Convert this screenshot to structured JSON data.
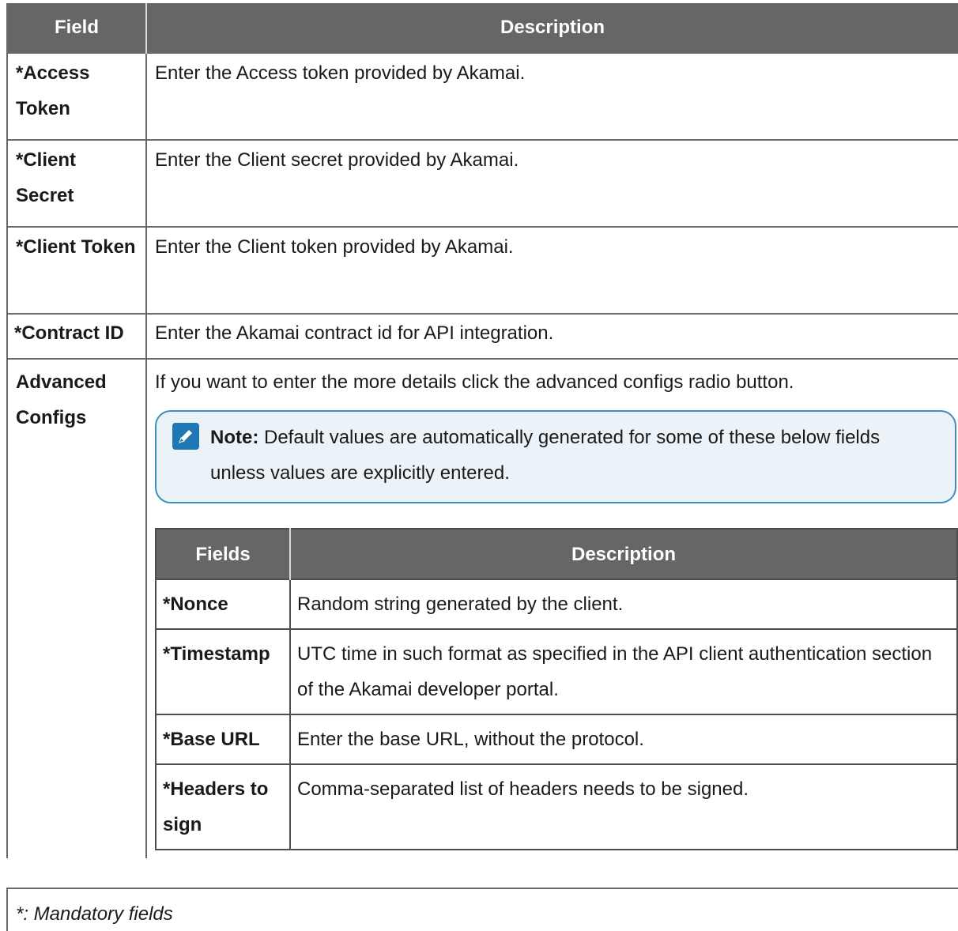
{
  "main_table": {
    "headers": {
      "field": "Field",
      "description": "Description"
    },
    "rows": [
      {
        "field": "*Access Token",
        "description": "Enter the Access token provided by Akamai."
      },
      {
        "field": "*Client Secret",
        "description": "Enter the Client secret provided by Akamai."
      },
      {
        "field": "*Client Token",
        "description": "Enter the Client token provided by Akamai."
      },
      {
        "field": "*Contract ID",
        "description": "Enter the Akamai contract id for API integration."
      },
      {
        "field": "Advanced Configs",
        "description": "If you want to enter the more details click the advanced configs radio button."
      }
    ]
  },
  "note": {
    "icon": "pencil-icon",
    "label": "Note:",
    "text": "Default values are automatically generated for some of these below fields unless values are explicitly entered."
  },
  "inner_table": {
    "headers": {
      "field": "Fields",
      "description": "Description"
    },
    "rows": [
      {
        "field": "*Nonce",
        "description": "Random string generated by the client."
      },
      {
        "field": "*Timestamp",
        "description": "UTC time in such format as specified in the API client authentication section of the Akamai developer portal."
      },
      {
        "field": "*Base URL",
        "description": "Enter the base URL, without the protocol."
      },
      {
        "field": "*Headers to sign",
        "description": "Comma-separated list of headers needs to be signed."
      }
    ]
  },
  "footer": {
    "text": "*: Mandatory fields"
  },
  "colors": {
    "header_bg": "#666666",
    "note_border": "#3b8fbf",
    "note_bg": "#ecf3f8",
    "icon_bg": "#1f78b4"
  }
}
